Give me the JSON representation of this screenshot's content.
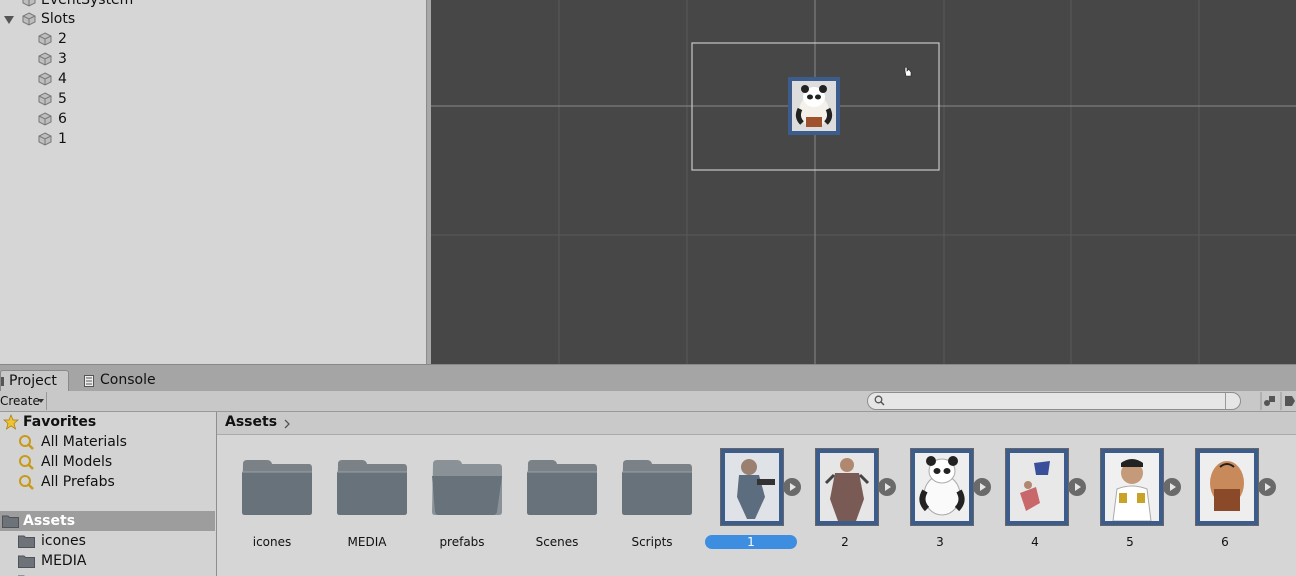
{
  "hierarchy": {
    "top_item": "EventSystem",
    "group": "Slots",
    "children": [
      "2",
      "3",
      "4",
      "5",
      "6",
      "1"
    ]
  },
  "tabs": {
    "project": "Project",
    "console": "Console"
  },
  "toolbar": {
    "create": "Create",
    "search_placeholder": ""
  },
  "tree": {
    "favorites": "Favorites",
    "favorite_items": [
      "All Materials",
      "All Models",
      "All Prefabs"
    ],
    "assets": "Assets",
    "asset_folders": [
      "icones",
      "MEDIA"
    ]
  },
  "breadcrumb": {
    "root": "Assets"
  },
  "assets": {
    "folders": [
      "icones",
      "MEDIA",
      "prefabs",
      "Scenes",
      "Scripts"
    ],
    "sprites": [
      "1",
      "2",
      "3",
      "4",
      "5",
      "6"
    ],
    "selected": "1"
  },
  "colors": {
    "selection": "#3d8de0",
    "scene_bg": "#474747",
    "thumb_border": "#3c5c8c"
  }
}
